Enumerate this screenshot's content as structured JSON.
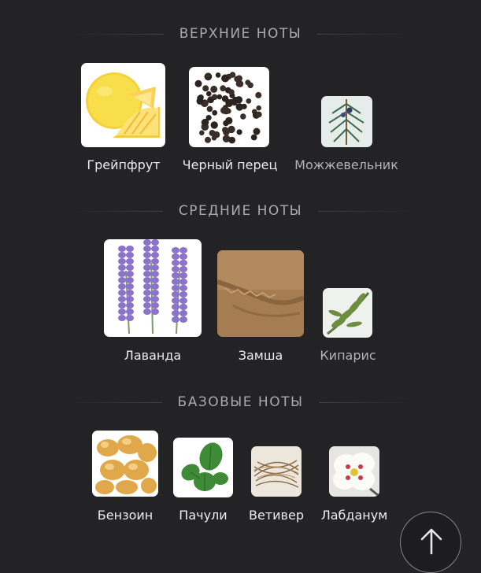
{
  "sections": {
    "top": {
      "title": "ВЕРХНИЕ НОТЫ",
      "notes": [
        {
          "label": "Грейпфрут",
          "icon": "grapefruit-image"
        },
        {
          "label": "Черный перец",
          "icon": "black-pepper-image"
        },
        {
          "label": "Можжевельник",
          "icon": "juniper-image"
        }
      ]
    },
    "middle": {
      "title": "СРЕДНИЕ НОТЫ",
      "notes": [
        {
          "label": "Лаванда",
          "icon": "lavender-image"
        },
        {
          "label": "Замша",
          "icon": "suede-image"
        },
        {
          "label": "Кипарис",
          "icon": "cypress-image"
        }
      ]
    },
    "base": {
      "title": "БАЗОВЫЕ НОТЫ",
      "notes": [
        {
          "label": "Бензоин",
          "icon": "benzoin-image"
        },
        {
          "label": "Пачули",
          "icon": "patchouli-image"
        },
        {
          "label": "Ветивер",
          "icon": "vetiver-image"
        },
        {
          "label": "Лабданум",
          "icon": "labdanum-image"
        }
      ]
    }
  },
  "scroll_top_button": {
    "icon": "arrow-up-icon"
  },
  "colors": {
    "background": "#232326",
    "heading": "#a9a9ae",
    "label": "#ececec"
  }
}
